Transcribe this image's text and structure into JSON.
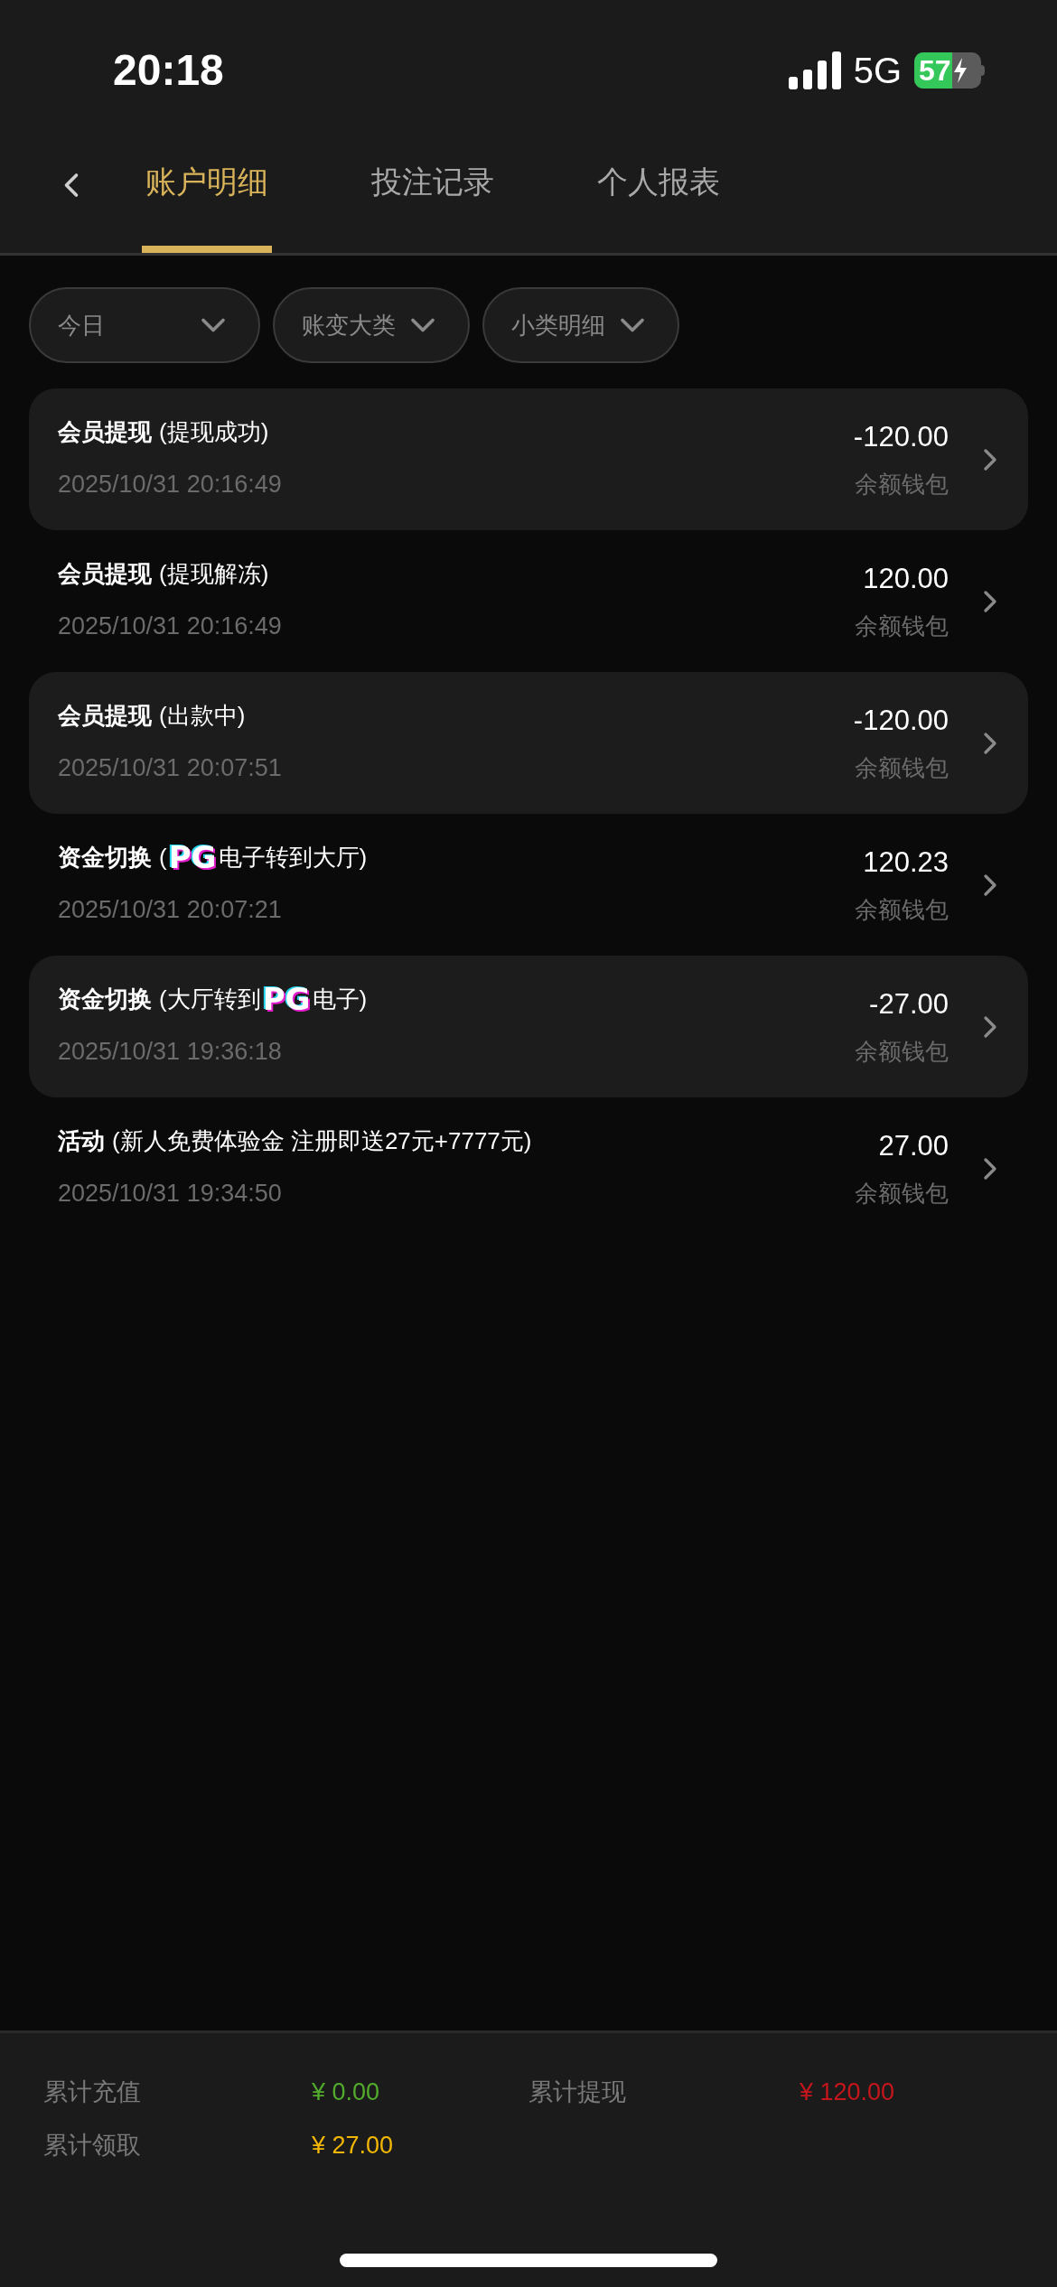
{
  "status_bar": {
    "time": "20:18",
    "network": "5G",
    "battery": "57"
  },
  "tabs": [
    {
      "label": "账户明细",
      "selected": true
    },
    {
      "label": "投注记录",
      "selected": false
    },
    {
      "label": "个人报表",
      "selected": false
    }
  ],
  "filters": [
    {
      "label": "今日"
    },
    {
      "label": "账变大类"
    },
    {
      "label": "小类明细"
    }
  ],
  "records": [
    {
      "shaded": true,
      "category": "会员提现",
      "detail": [
        {
          "kind": "text",
          "text": "(提现成功)"
        }
      ],
      "time": "2025/10/31 20:16:49",
      "amount": "-120.00",
      "wallet": "余额钱包"
    },
    {
      "shaded": false,
      "category": "会员提现",
      "detail": [
        {
          "kind": "text",
          "text": "(提现解冻)"
        }
      ],
      "time": "2025/10/31 20:16:49",
      "amount": "120.00",
      "wallet": "余额钱包"
    },
    {
      "shaded": true,
      "category": "会员提现",
      "detail": [
        {
          "kind": "text",
          "text": "(出款中)"
        }
      ],
      "time": "2025/10/31 20:07:51",
      "amount": "-120.00",
      "wallet": "余额钱包"
    },
    {
      "shaded": false,
      "category": "资金切换",
      "detail": [
        {
          "kind": "text",
          "text": "("
        },
        {
          "kind": "logo",
          "text": "PG"
        },
        {
          "kind": "text",
          "text": "电子转到大厅)"
        }
      ],
      "time": "2025/10/31 20:07:21",
      "amount": "120.23",
      "wallet": "余额钱包"
    },
    {
      "shaded": true,
      "category": "资金切换",
      "detail": [
        {
          "kind": "text",
          "text": "(大厅转到"
        },
        {
          "kind": "logo",
          "text": "PG"
        },
        {
          "kind": "text",
          "text": "电子)"
        }
      ],
      "time": "2025/10/31 19:36:18",
      "amount": "-27.00",
      "wallet": "余额钱包"
    },
    {
      "shaded": false,
      "category": "活动",
      "detail": [
        {
          "kind": "text",
          "text": "(新人免费体验金 注册即送27元+7777元)"
        }
      ],
      "time": "2025/10/31 19:34:50",
      "amount": "27.00",
      "wallet": "余额钱包"
    }
  ],
  "summary": [
    {
      "label": "累计充值",
      "value": "¥ 0.00",
      "color": "#52ab2c"
    },
    {
      "label": "累计提现",
      "value": "¥ 120.00",
      "color": "#c4161c"
    },
    {
      "label": "累计领取",
      "value": "¥ 27.00",
      "color": "#f2b705"
    }
  ]
}
